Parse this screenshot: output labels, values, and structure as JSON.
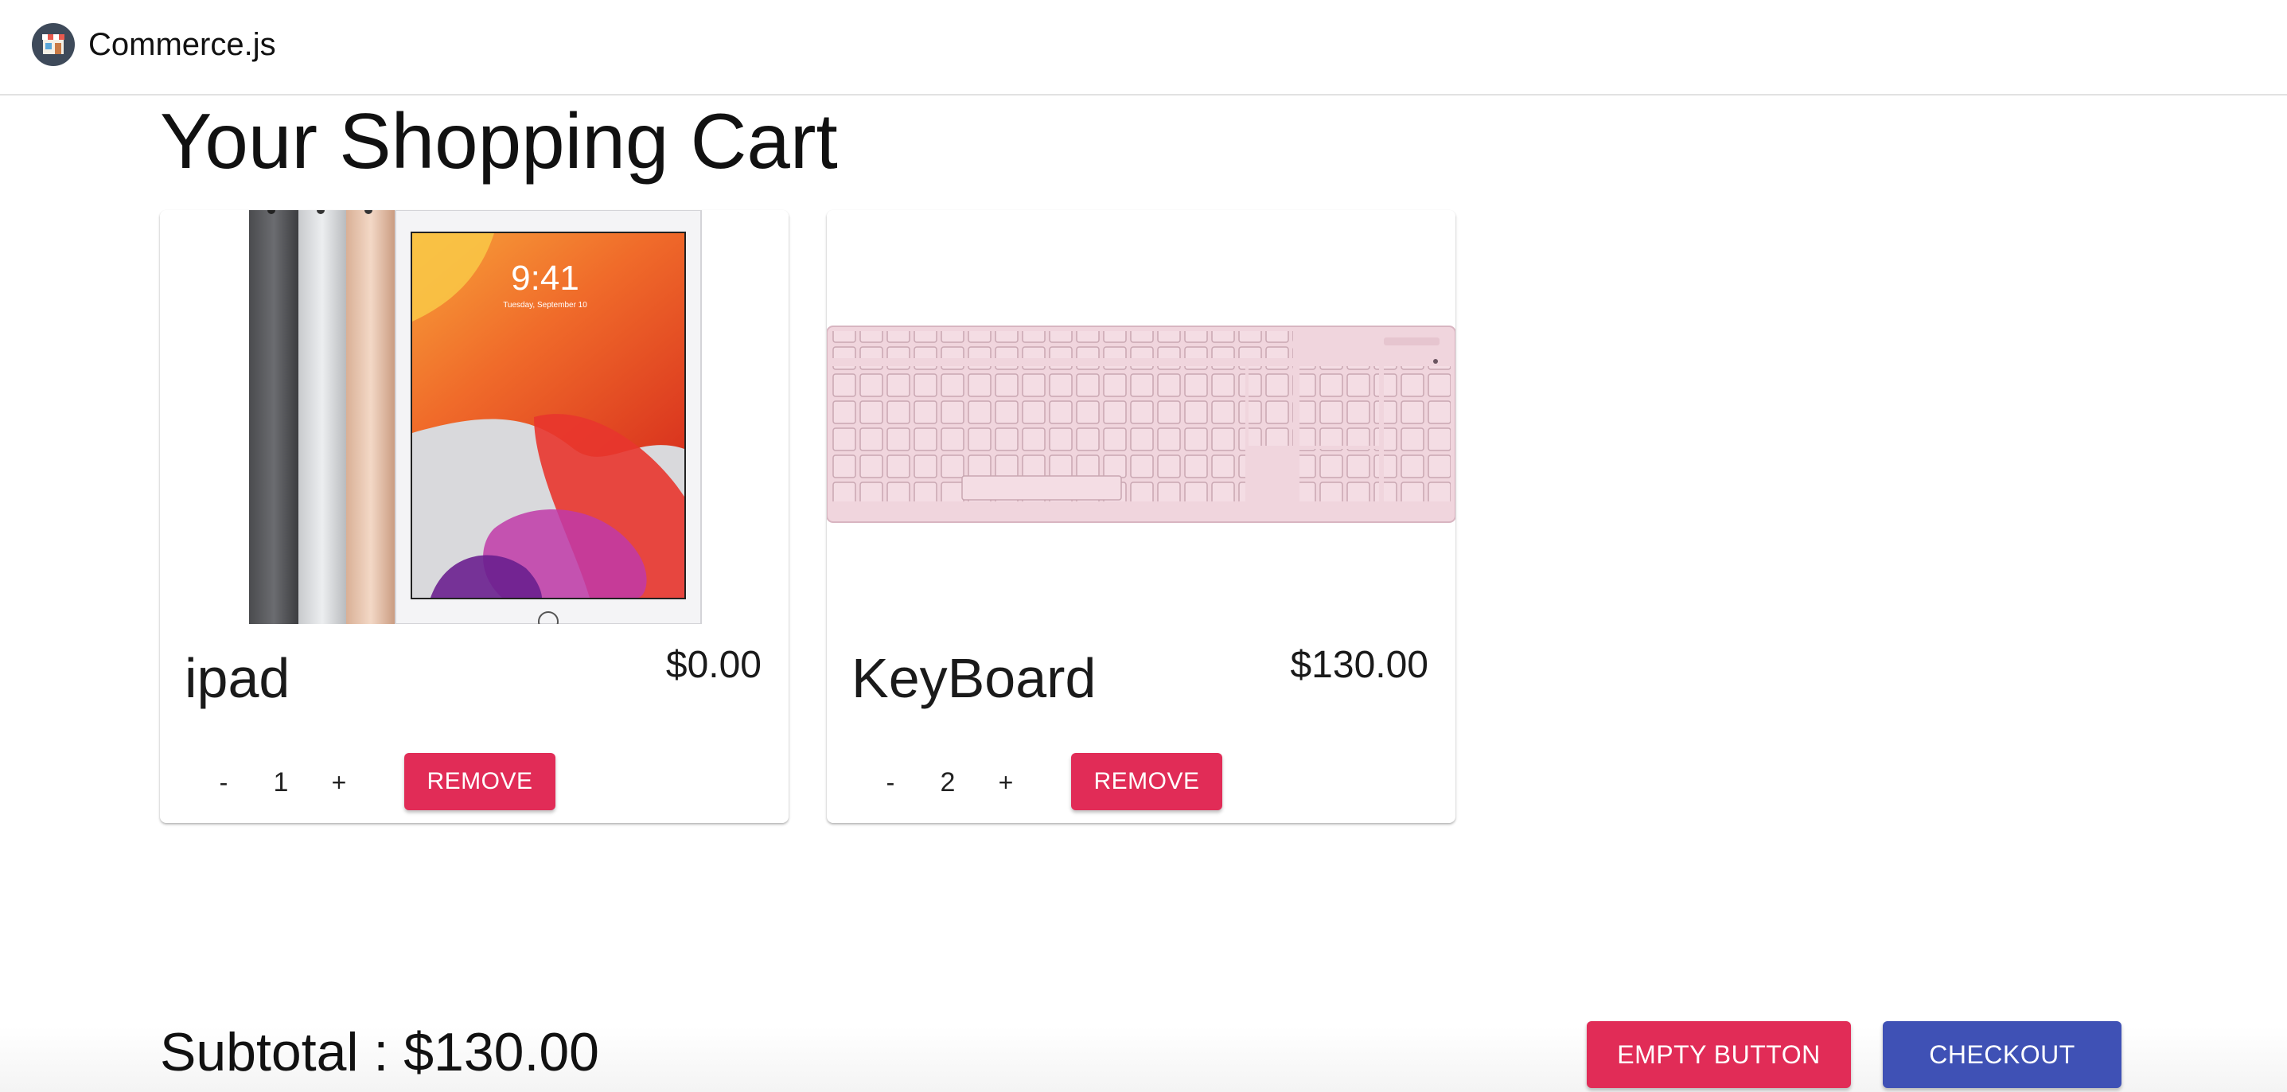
{
  "header": {
    "brand": "Commerce.js",
    "logo_icon": "storefront-icon"
  },
  "page_title": "Your Shopping Cart",
  "cart": {
    "items": [
      {
        "name": "ipad",
        "price": "$0.00",
        "quantity": "1",
        "decrement_label": "-",
        "increment_label": "+",
        "remove_label": "REMOVE",
        "image": {
          "lock_time": "9:41",
          "lock_date": "Tuesday, September 10"
        }
      },
      {
        "name": "KeyBoard",
        "price": "$130.00",
        "quantity": "2",
        "decrement_label": "-",
        "increment_label": "+",
        "remove_label": "REMOVE"
      }
    ]
  },
  "footer": {
    "subtotal": "Subtotal : $130.00",
    "empty_label": "EMPTY BUTTON",
    "checkout_label": "CHECKOUT"
  },
  "colors": {
    "secondary": "#e12c57",
    "primary": "#3f51b5"
  }
}
